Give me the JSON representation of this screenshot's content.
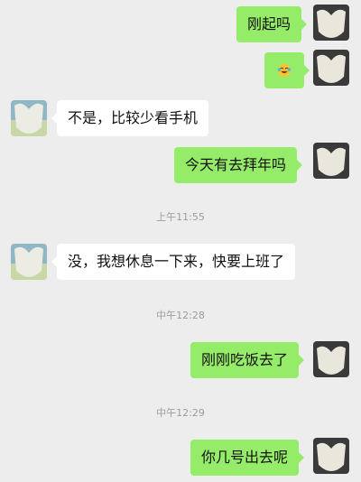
{
  "messages": [
    {
      "side": "out",
      "text": "刚起吗"
    },
    {
      "side": "out",
      "icon": "laughing-tears-emoji",
      "text": ""
    },
    {
      "side": "in",
      "text": "不是，比较少看手机"
    },
    {
      "side": "out",
      "text": "今天有去拜年吗"
    },
    {
      "side": "time",
      "text": "上午11:55"
    },
    {
      "side": "in",
      "text": "没，我想休息一下来，快要上班了"
    },
    {
      "side": "time",
      "text": "中午12:28"
    },
    {
      "side": "out",
      "text": "刚刚吃饭去了"
    },
    {
      "side": "time",
      "text": "中午12:29"
    },
    {
      "side": "out",
      "text": "你几号出去呢"
    }
  ],
  "colors": {
    "background": "#ededed",
    "outgoing_bubble": "#95ec69",
    "incoming_bubble": "#ffffff",
    "timestamp": "#9c9c9c"
  }
}
